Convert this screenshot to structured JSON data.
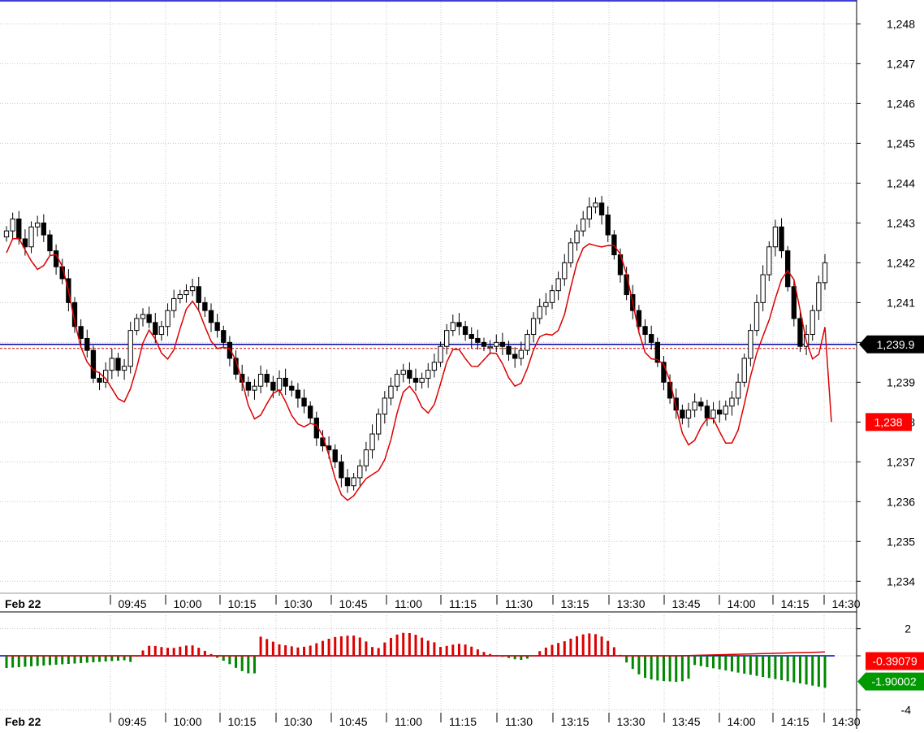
{
  "chart_data": [
    {
      "type": "candlestick",
      "panel": "price",
      "date_label": "Feb 22",
      "time_labels": [
        "09:45",
        "10:00",
        "10:15",
        "10:30",
        "10:45",
        "11:00",
        "11:15",
        "11:30",
        "13:15",
        "13:30",
        "13:45",
        "14:00",
        "14:15",
        "14:30"
      ],
      "y_ticks": [
        "1,248",
        "1,247",
        "1,246",
        "1,245",
        "1,244",
        "1,243",
        "1,242",
        "1,241",
        "1,240",
        "1,239",
        "1,238",
        "1,237",
        "1,236",
        "1,235",
        "1,234"
      ],
      "ylim": [
        1233.7,
        1248.6
      ],
      "grid": true,
      "last_price_label": "1,239.9",
      "last_price": 1239.95,
      "overlay_label": "1,238",
      "overlay_last": 1238.0,
      "reference_levels": [
        1248.5,
        1239.95,
        1239.85
      ],
      "candle_closes": [
        1242.8,
        1243.1,
        1242.6,
        1242.4,
        1242.9,
        1243.0,
        1242.7,
        1242.3,
        1241.9,
        1241.6,
        1241.0,
        1240.4,
        1240.1,
        1239.8,
        1239.1,
        1239.0,
        1239.3,
        1239.6,
        1239.3,
        1239.4,
        1240.3,
        1240.6,
        1240.7,
        1240.5,
        1240.2,
        1240.4,
        1240.8,
        1241.1,
        1241.2,
        1241.3,
        1241.4,
        1241.0,
        1240.8,
        1240.5,
        1240.3,
        1240.0,
        1239.6,
        1239.2,
        1239.0,
        1238.8,
        1238.9,
        1239.2,
        1239.0,
        1238.8,
        1239.1,
        1238.9,
        1238.8,
        1238.6,
        1238.4,
        1238.1,
        1237.6,
        1237.4,
        1237.3,
        1237.0,
        1236.6,
        1236.4,
        1236.6,
        1236.9,
        1237.3,
        1237.7,
        1238.2,
        1238.6,
        1238.9,
        1239.2,
        1239.3,
        1239.1,
        1239.0,
        1239.1,
        1239.3,
        1239.5,
        1239.9,
        1240.3,
        1240.5,
        1240.4,
        1240.2,
        1240.1,
        1240.0,
        1239.9,
        1239.9,
        1240.0,
        1239.9,
        1239.7,
        1239.6,
        1239.8,
        1240.2,
        1240.6,
        1240.9,
        1241.0,
        1241.3,
        1241.6,
        1242.0,
        1242.5,
        1242.8,
        1243.1,
        1243.4,
        1243.5,
        1243.2,
        1242.7,
        1242.2,
        1241.7,
        1241.2,
        1240.8,
        1240.4,
        1240.2,
        1240.0,
        1239.5,
        1239.0,
        1238.6,
        1238.3,
        1238.1,
        1238.3,
        1238.5,
        1238.4,
        1238.1,
        1238.3,
        1238.2,
        1238.4,
        1238.6,
        1239.0,
        1239.6,
        1240.3,
        1241.0,
        1241.7,
        1242.4,
        1242.9,
        1242.3,
        1241.4,
        1240.6,
        1239.9,
        1240.2,
        1240.8,
        1241.5,
        1242.0
      ]
    },
    {
      "type": "histogram",
      "panel": "oscillator",
      "date_label": "Feb 22",
      "time_labels": [
        "09:45",
        "10:00",
        "10:15",
        "10:30",
        "10:45",
        "11:00",
        "11:15",
        "11:30",
        "13:15",
        "13:30",
        "13:45",
        "14:00",
        "14:15",
        "14:30"
      ],
      "y_ticks": [
        "2",
        "0",
        "-4"
      ],
      "ylim": [
        -4.2,
        3.0
      ],
      "histogram_last_label": "-0.39079",
      "histogram_last": -0.39079,
      "signal_last_label": "-1.90002",
      "signal_last": -1.90002,
      "positive_color": "#dd0000",
      "negative_color": "#008800",
      "signal_color": "#dd0000",
      "zero_line_color": "#0000cc"
    }
  ]
}
